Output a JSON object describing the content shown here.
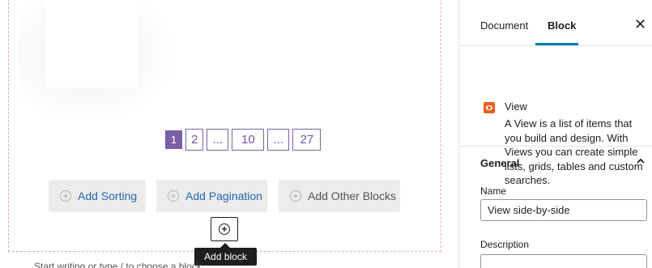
{
  "canvas": {
    "pagination": {
      "pages": [
        "1",
        "2",
        "...",
        "10",
        "...",
        "27"
      ],
      "current": "1"
    },
    "buttons": {
      "add_sorting": "Add Sorting",
      "add_pagination": "Add Pagination",
      "add_other_blocks": "Add Other Blocks"
    },
    "add_block_tooltip": "Add block",
    "bottom_text": "Start writing or type / to choose a block"
  },
  "sidebar": {
    "tabs": [
      {
        "label": "Document",
        "active": false
      },
      {
        "label": "Block",
        "active": true
      }
    ],
    "close_icon": "close-icon",
    "block": {
      "icon": "view-eye-icon",
      "name": "View",
      "description": "A View is a list of items that you build and design. With Views you can create simple lists, grids, tables and custom searches."
    },
    "panel": {
      "title": "General",
      "expanded": true,
      "name_label": "Name",
      "name_value": "View side-by-side",
      "description_label": "Description",
      "description_value": ""
    }
  },
  "colors": {
    "accent_blue": "#007cba",
    "pagination_purple": "#7b5fa8",
    "dashed_border": "#e8a8ad",
    "view_icon_orange": "#ea5e1f"
  }
}
